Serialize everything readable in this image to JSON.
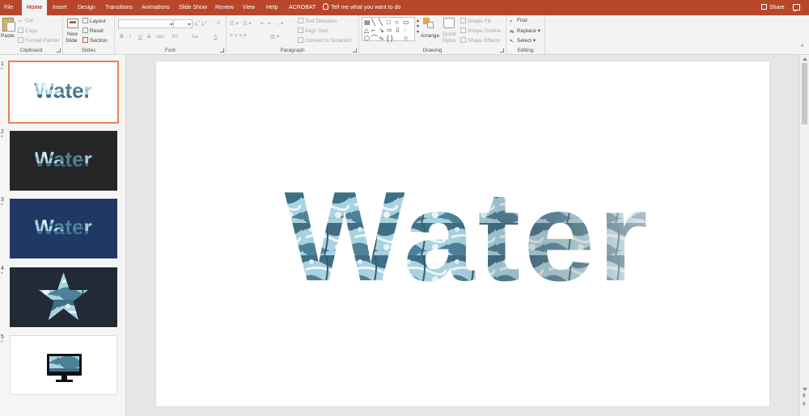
{
  "tabs": [
    {
      "label": "File",
      "active": false
    },
    {
      "label": "Home",
      "active": true
    },
    {
      "label": "Insert",
      "active": false
    },
    {
      "label": "Design",
      "active": false
    },
    {
      "label": "Transitions",
      "active": false
    },
    {
      "label": "Animations",
      "active": false
    },
    {
      "label": "Slide Show",
      "active": false
    },
    {
      "label": "Review",
      "active": false
    },
    {
      "label": "View",
      "active": false
    },
    {
      "label": "Help",
      "active": false
    },
    {
      "label": "ACROBAT",
      "active": false
    }
  ],
  "tell_me": "Tell me what you want to do",
  "share_label": "Share",
  "ribbon": {
    "clipboard": {
      "paste": "Paste",
      "cut": "Cut",
      "copy": "Copy",
      "format_painter": "Format Painter",
      "label": "Clipboard"
    },
    "slides": {
      "new_slide": "New",
      "new_slide_2": "Slide",
      "layout": "Layout",
      "reset": "Reset",
      "section": "Section",
      "label": "Slides"
    },
    "font": {
      "bold": "B",
      "italic": "I",
      "underline": "U",
      "strike": "S",
      "shadow": "abc",
      "spacing": "AV",
      "case": "Aa",
      "color": "A",
      "label": "Font"
    },
    "paragraph": {
      "text_direction": "Text Direction",
      "align_text": "Align Text",
      "smartart": "Convert to SmartArt",
      "label": "Paragraph"
    },
    "drawing": {
      "arrange": "Arrange",
      "quick_styles": "Quick",
      "quick_styles_2": "Styles",
      "shape_fill": "Shape Fill",
      "shape_outline": "Shape Outline",
      "shape_effects": "Shape Effects",
      "label": "Drawing"
    },
    "editing": {
      "find": "Find",
      "replace": "Replace",
      "select": "Select",
      "label": "Editing"
    }
  },
  "slides": [
    {
      "number": "1",
      "marker": "*",
      "text": "Water",
      "background": "#ffffff",
      "selected": true
    },
    {
      "number": "2",
      "marker": "*",
      "text": "Water",
      "background": "#262626",
      "selected": false
    },
    {
      "number": "3",
      "marker": "*",
      "text": "Water",
      "background": "#1f3864",
      "selected": false
    },
    {
      "number": "4",
      "marker": "*",
      "background": "#222a35",
      "selected": false
    },
    {
      "number": "5",
      "marker": "*",
      "background": "#ffffff",
      "selected": false
    }
  ],
  "main_slide": {
    "text": "Water"
  },
  "colors": {
    "accent": "#b7472a",
    "water_dark": "#3d6c82",
    "water_light": "#cfe8f0",
    "selection": "#e4835b"
  }
}
